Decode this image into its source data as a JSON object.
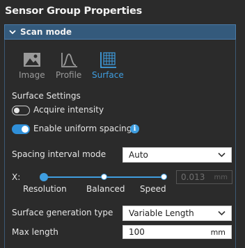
{
  "panel": {
    "title": "Sensor Group Properties"
  },
  "section": {
    "title": "Scan mode"
  },
  "modes": [
    {
      "label": "Image",
      "icon": "image-icon",
      "active": false
    },
    {
      "label": "Profile",
      "icon": "profile-icon",
      "active": false
    },
    {
      "label": "Surface",
      "icon": "surface-icon",
      "active": true
    }
  ],
  "surface_settings": {
    "heading": "Surface Settings",
    "acquire_intensity": {
      "label": "Acquire intensity",
      "on": false
    },
    "uniform_spacing": {
      "label": "Enable uniform spacing",
      "on": true,
      "info": "i"
    }
  },
  "spacing": {
    "label": "Spacing interval mode",
    "value": "Auto"
  },
  "slider": {
    "axis_label": "X:",
    "stops": [
      "Resolution",
      "Balanced",
      "Speed"
    ],
    "selected": "Resolution",
    "value": "0.013",
    "unit": "mm"
  },
  "generation": {
    "label": "Surface generation type",
    "value": "Variable Length"
  },
  "max_length": {
    "label": "Max length",
    "value": "100",
    "unit": "mm"
  },
  "colors": {
    "accent": "#3f9ee0",
    "header_bg": "#345a7c",
    "panel_bg": "#2b2b2b"
  }
}
